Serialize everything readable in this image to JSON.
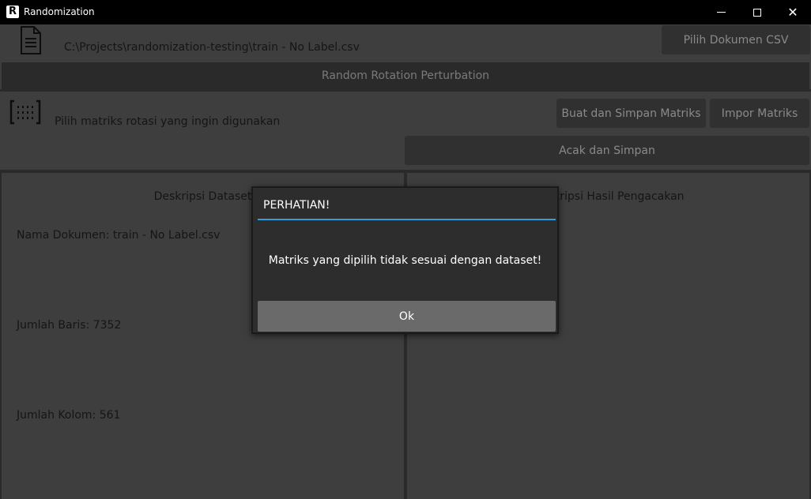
{
  "window": {
    "title": "Randomization",
    "icon": "app-r-icon",
    "controls": {
      "minimize": "minimize-icon",
      "maximize": "maximize-icon",
      "close": "✕"
    }
  },
  "file": {
    "icon": "document-icon",
    "path": "C:\\Projects\\randomization-testing\\train - No Label.csv",
    "pick_button": "Pilih Dokumen CSV"
  },
  "section": {
    "title": "Random Rotation Perturbation"
  },
  "matrix": {
    "icon": "matrix-icon",
    "label": "Pilih matriks rotasi yang ingin digunakan",
    "create_button": "Buat dan Simpan Matriks",
    "import_button": "Impor Matriks",
    "shuffle_button": "Acak dan Simpan"
  },
  "panels": {
    "left": {
      "title": "Deskripsi Dataset",
      "name_line": "Nama Dokumen: train - No Label.csv",
      "rows_line": "Jumlah Baris: 7352",
      "cols_line": "Jumlah Kolom: 561"
    },
    "right": {
      "title": "Deskripsi Hasil Pengacakan"
    }
  },
  "dialog": {
    "title": "PERHATIAN!",
    "message": "Matriks yang dipilih tidak sesuai dengan dataset!",
    "ok_button": "Ok"
  },
  "colors": {
    "background": "#3e3e3e",
    "button": "#303030",
    "accent": "#2e9fd8",
    "dialog": "#2d2d2d"
  }
}
